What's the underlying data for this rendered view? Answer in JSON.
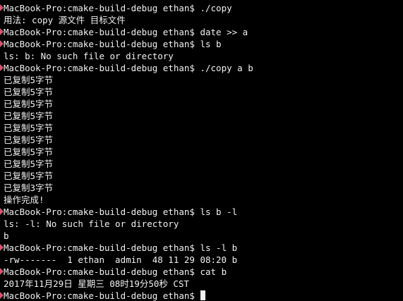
{
  "terminal": {
    "marker_color": "#e0506e",
    "lines": [
      {
        "type": "prompt",
        "prompt": "MacBook-Pro:cmake-build-debug ethan$",
        "command": "./copy"
      },
      {
        "type": "output",
        "text": "用法: copy 源文件 目标文件"
      },
      {
        "type": "prompt",
        "prompt": "MacBook-Pro:cmake-build-debug ethan$",
        "command": "date >> a"
      },
      {
        "type": "prompt",
        "prompt": "MacBook-Pro:cmake-build-debug ethan$",
        "command": "ls b"
      },
      {
        "type": "output",
        "text": "ls: b: No such file or directory"
      },
      {
        "type": "prompt",
        "prompt": "MacBook-Pro:cmake-build-debug ethan$",
        "command": "./copy a b"
      },
      {
        "type": "output",
        "text": "已复制5字节"
      },
      {
        "type": "output",
        "text": "已复制5字节"
      },
      {
        "type": "output",
        "text": "已复制5字节"
      },
      {
        "type": "output",
        "text": "已复制5字节"
      },
      {
        "type": "output",
        "text": "已复制5字节"
      },
      {
        "type": "output",
        "text": "已复制5字节"
      },
      {
        "type": "output",
        "text": "已复制5字节"
      },
      {
        "type": "output",
        "text": "已复制5字节"
      },
      {
        "type": "output",
        "text": "已复制5字节"
      },
      {
        "type": "output",
        "text": "已复制3字节"
      },
      {
        "type": "output",
        "text": "操作完成!"
      },
      {
        "type": "prompt",
        "prompt": "MacBook-Pro:cmake-build-debug ethan$",
        "command": "ls b -l"
      },
      {
        "type": "output",
        "text": "ls: -l: No such file or directory"
      },
      {
        "type": "output",
        "text": "b"
      },
      {
        "type": "prompt",
        "prompt": "MacBook-Pro:cmake-build-debug ethan$",
        "command": "ls -l b"
      },
      {
        "type": "output",
        "text": "-rw-------  1 ethan  admin  48 11 29 08:20 b"
      },
      {
        "type": "prompt",
        "prompt": "MacBook-Pro:cmake-build-debug ethan$",
        "command": "cat b"
      },
      {
        "type": "output",
        "text": "2017年11月29日 星期三 08时19分50秒 CST"
      },
      {
        "type": "prompt",
        "prompt": "MacBook-Pro:cmake-build-debug ethan$",
        "command": "",
        "cursor": true
      }
    ]
  }
}
